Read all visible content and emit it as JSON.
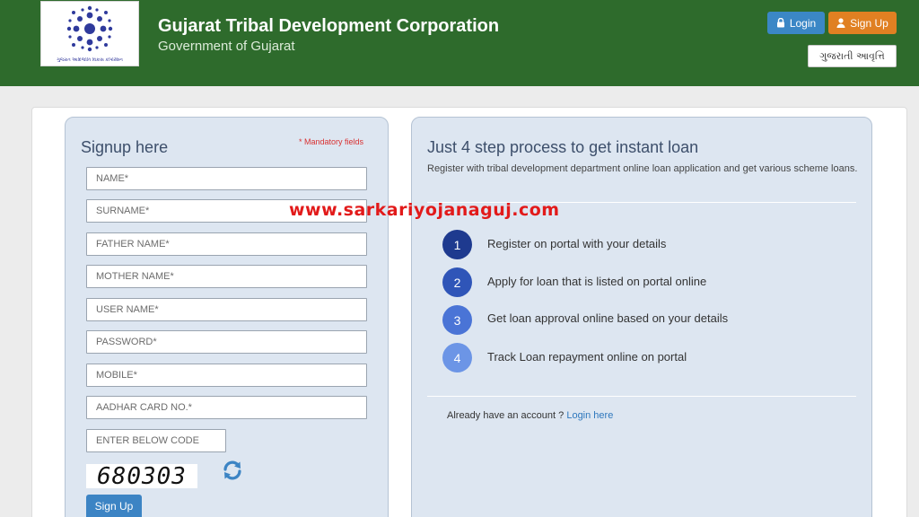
{
  "header": {
    "title": "Gujarat Tribal Development Corporation",
    "subtitle": "Government of Gujarat",
    "logo_caption": "ગુજરાત આદિજાતિ વિકાસ કોર્પોરેશન",
    "login_label": "Login",
    "signup_label": "Sign Up",
    "language_label": "ગુજરાતી આવૃત્તિ"
  },
  "signup": {
    "title": "Signup here",
    "mandatory_note": "* Mandatory fields",
    "fields": {
      "name": "NAME*",
      "surname": "SURNAME*",
      "father_name": "FATHER NAME*",
      "mother_name": "MOTHER NAME*",
      "user_name": "USER NAME*",
      "password": "PASSWORD*",
      "mobile": "MOBILE*",
      "aadhar": "AADHAR CARD NO.*",
      "code": "ENTER BELOW CODE"
    },
    "captcha": "680303",
    "submit_label": "Sign Up"
  },
  "info": {
    "title": "Just 4 step process to get instant loan",
    "description": "Register with tribal development department online loan application and get various scheme loans.",
    "steps": [
      {
        "number": "1",
        "text": "Register on portal with your details",
        "color": "#1e3a8f"
      },
      {
        "number": "2",
        "text": "Apply for loan that is listed on portal online",
        "color": "#2f55b8"
      },
      {
        "number": "3",
        "text": "Get loan approval online based on your details",
        "color": "#4a74d6"
      },
      {
        "number": "4",
        "text": "Track Loan repayment online on portal",
        "color": "#6c95e6"
      }
    ],
    "account_prompt": "Already have an account ?",
    "login_link": "Login here"
  },
  "watermark": "www.sarkariyojanaguj.com",
  "colors": {
    "header_bg": "#2e6b2c",
    "login_btn": "#3b87c6",
    "signup_btn": "#e08022",
    "panel_bg": "#dde6f1",
    "watermark": "#e21a1a"
  }
}
